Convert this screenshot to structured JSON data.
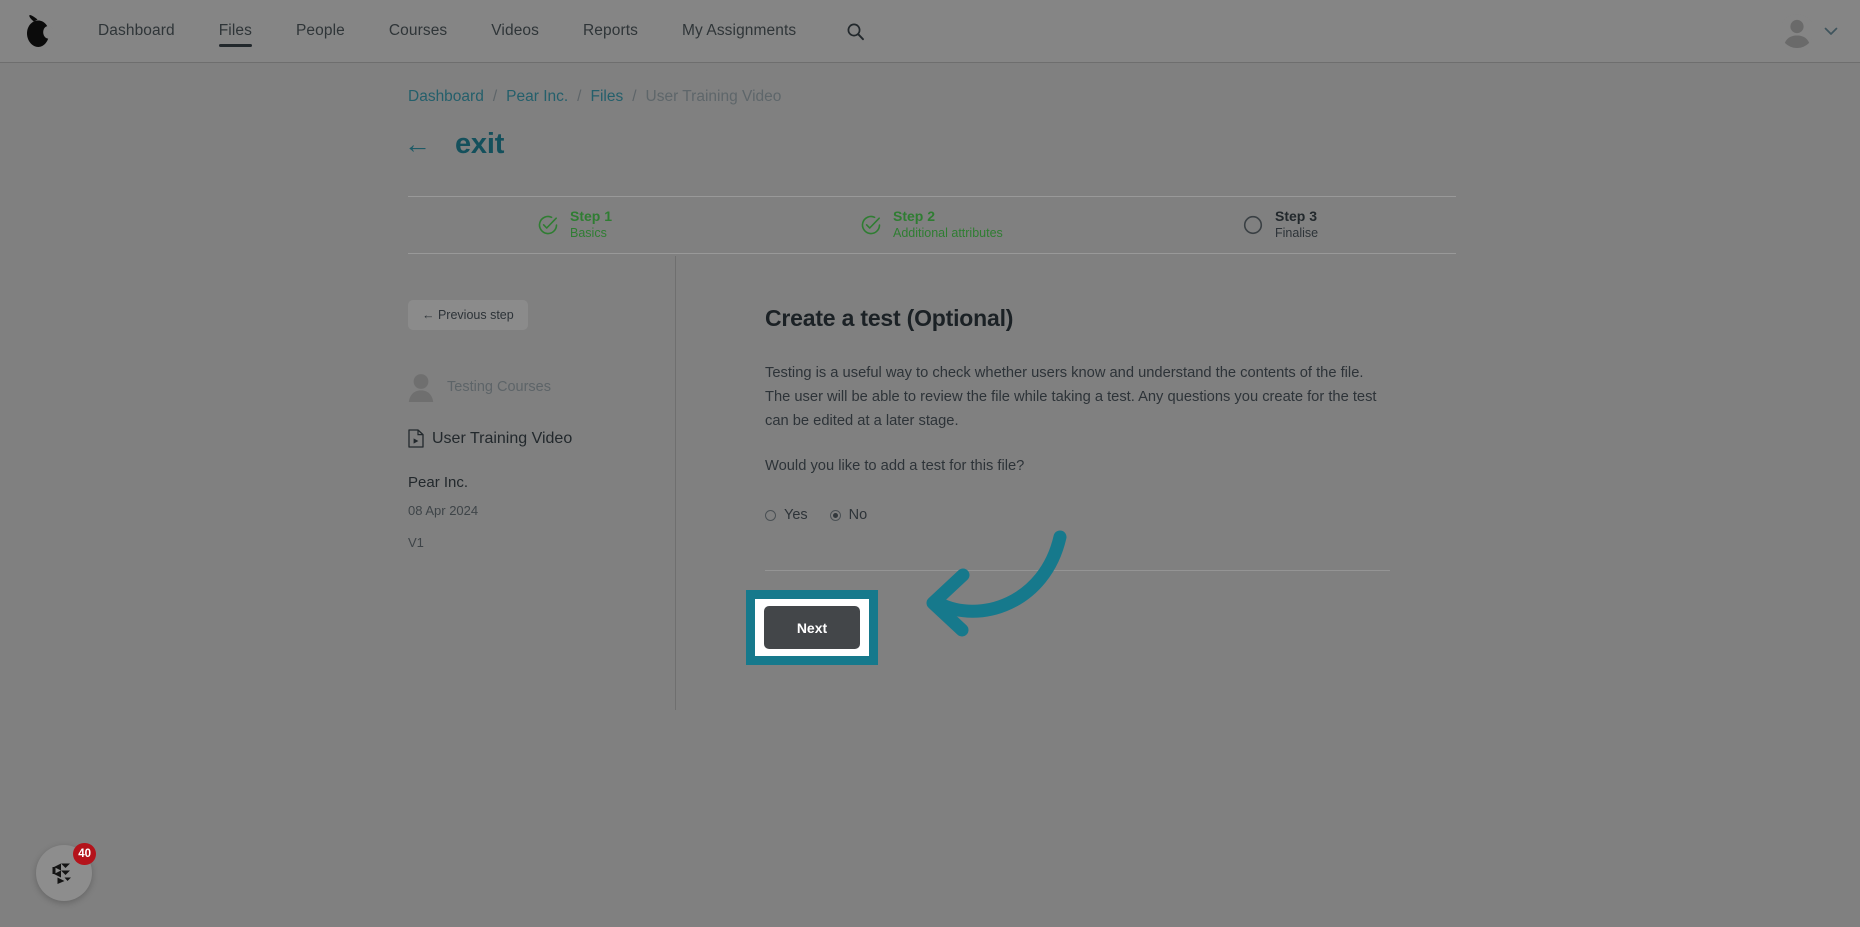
{
  "app": {
    "logo_icon": "pear-logo-icon",
    "accent_teal": "#16798c",
    "page_overlay_color": "#808080",
    "success_green": "#2f7d32",
    "badge_red": "#b4131b"
  },
  "topnav": {
    "links": [
      {
        "label": "Dashboard",
        "active": false
      },
      {
        "label": "Files",
        "active": true
      },
      {
        "label": "People",
        "active": false
      },
      {
        "label": "Courses",
        "active": false
      },
      {
        "label": "Videos",
        "active": false
      },
      {
        "label": "Reports",
        "active": false
      },
      {
        "label": "My Assignments",
        "active": false
      }
    ],
    "search_icon": "search-icon",
    "avatar_icon": "user-avatar-icon",
    "caret_icon": "chevron-down-icon"
  },
  "breadcrumb": {
    "items": [
      {
        "label": "Dashboard",
        "current": false
      },
      {
        "label": "Pear Inc.",
        "current": false
      },
      {
        "label": "Files",
        "current": false
      },
      {
        "label": "User Training Video",
        "current": true
      }
    ],
    "separator": "/"
  },
  "exit": {
    "arrow": "←",
    "label": "exit"
  },
  "steps": [
    {
      "id": "step-1",
      "title": "Step 1",
      "subtitle": "Basics",
      "state": "done",
      "icon": "check-circle-icon"
    },
    {
      "id": "step-2",
      "title": "Step 2",
      "subtitle": "Additional attributes",
      "state": "done",
      "icon": "check-circle-icon"
    },
    {
      "id": "step-3",
      "title": "Step 3",
      "subtitle": "Finalise",
      "state": "todo",
      "icon": "empty-circle-icon"
    }
  ],
  "info_panel": {
    "previous_step_label": "← Previous step",
    "course_avatar_icon": "user-avatar-icon",
    "course_name": "Testing Courses",
    "file_icon": "file-video-icon",
    "file_name": "User Training Video",
    "organisation": "Pear Inc.",
    "date": "08 Apr 2024",
    "version": "V1"
  },
  "content": {
    "title": "Create a test (Optional)",
    "paragraph": "Testing is a useful way to check whether users know and understand the contents of the file. The user will be able to review the file while taking a test. Any questions you create for the test can be edited at a later stage.",
    "question": "Would you like to add a test for this file?",
    "radio_options": [
      {
        "label": "Yes",
        "selected": false
      },
      {
        "label": "No",
        "selected": true
      }
    ],
    "next_label": "Next"
  },
  "annotation": {
    "highlight_target": "next-button",
    "arrow_icon": "curved-left-arrow-icon",
    "arrow_color": "#16798c"
  },
  "help_widget": {
    "icon": "chat-help-icon",
    "badge_count": "40"
  }
}
